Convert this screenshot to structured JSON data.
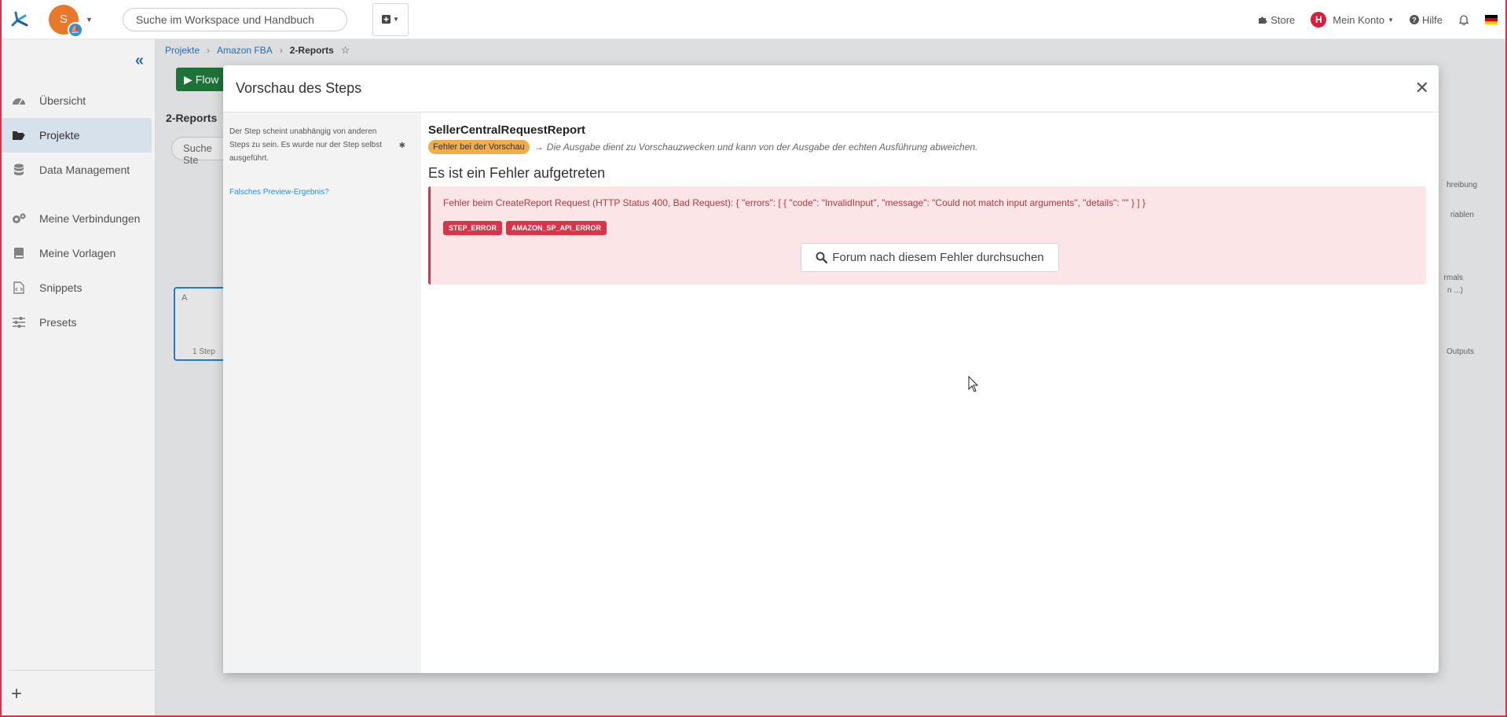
{
  "topbar": {
    "avatar_letter": "S",
    "search_placeholder": "Suche im Workspace und Handbuch",
    "store_label": "Store",
    "account_letter": "H",
    "account_label": "Mein Konto",
    "help_label": "Hilfe"
  },
  "sidebar": {
    "items": [
      {
        "label": "Übersicht",
        "icon": "dashboard-icon"
      },
      {
        "label": "Projekte",
        "icon": "folder-open-icon",
        "active": true
      },
      {
        "label": "Data Management",
        "icon": "database-icon"
      },
      {
        "label": "Meine Verbindungen",
        "icon": "cogs-icon"
      },
      {
        "label": "Meine Vorlagen",
        "icon": "book-icon"
      },
      {
        "label": "Snippets",
        "icon": "code-file-icon"
      },
      {
        "label": "Presets",
        "icon": "sliders-icon"
      }
    ],
    "add_label": "+"
  },
  "background": {
    "breadcrumb": [
      "Projekte",
      "Amazon FBA",
      "2-Reports"
    ],
    "flow_button": "Flow",
    "title": "2-Reports",
    "search_placeholder": "Suche Ste",
    "node_letter": "A",
    "node_footer": "1 Step",
    "right_labels": [
      "hreibung",
      "riablen",
      "rmals",
      "n ...)",
      "Outputs"
    ]
  },
  "modal": {
    "title": "Vorschau des Steps",
    "left_hint": "Der Step scheint unabhängig von anderen Steps zu sein. Es wurde nur der Step selbst ausgeführt.",
    "left_link": "Falsches Preview-Ergebnis?",
    "step_name": "SellerCentralRequestReport",
    "status_badge": "Fehler bei der Vorschau",
    "status_note": "Die Ausgabe dient zu Vorschauzwecken und kann von der Ausgabe der echten Ausführung abweichen.",
    "error_heading": "Es ist ein Fehler aufgetreten",
    "error_message": "Fehler beim CreateReport Request (HTTP Status 400, Bad Request): { \"errors\": [ { \"code\": \"InvalidInput\", \"message\": \"Could not match input arguments\", \"details\": \"\" } ] }",
    "error_codes": [
      "STEP_ERROR",
      "AMAZON_SP_API_ERROR"
    ],
    "forum_button": "Forum nach diesem Fehler durchsuchen"
  },
  "colors": {
    "accent": "#2774ba",
    "error": "#d9354a",
    "warning": "#f0ad4e",
    "avatar": "#e8782a"
  }
}
